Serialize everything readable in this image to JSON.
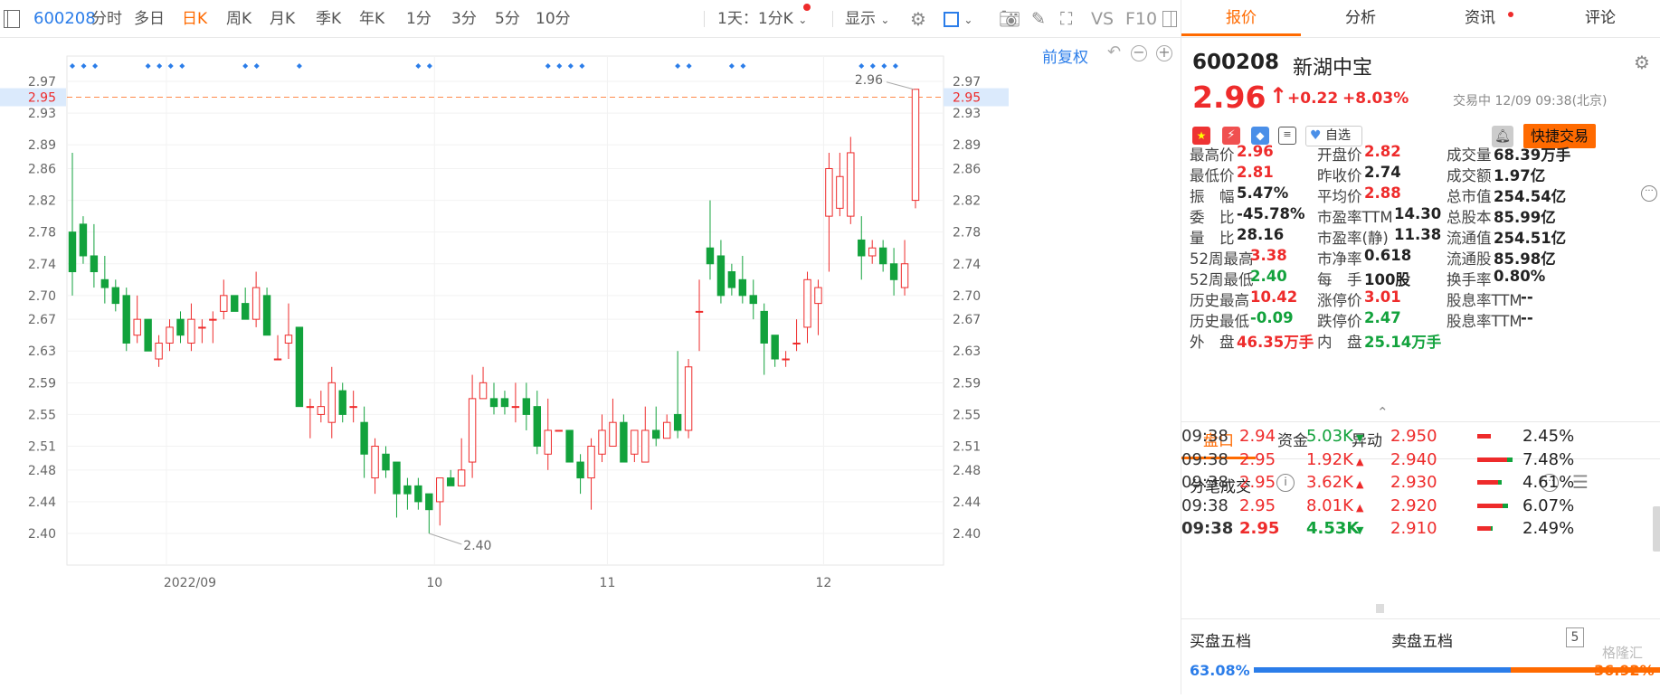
{
  "toolbar": {
    "code": "600208",
    "tabs": [
      "分时",
      "多日",
      "日K",
      "周K",
      "月K",
      "季K",
      "年K",
      "1分",
      "3分",
      "5分",
      "10分"
    ],
    "active_tab": "日K",
    "period_select": "1天：1分K",
    "display_select": "显示",
    "vs": "VS",
    "f10": "F10"
  },
  "chart": {
    "restore_label": "前复权",
    "y_ticks": [
      "2.97",
      "2.93",
      "2.89",
      "2.86",
      "2.82",
      "2.78",
      "2.74",
      "2.70",
      "2.67",
      "2.63",
      "2.59",
      "2.55",
      "2.51",
      "2.48",
      "2.44",
      "2.40"
    ],
    "cursor_price": "2.95",
    "x_labels": [
      "2022/09",
      "10",
      "11",
      "12"
    ],
    "high_label": "2.96",
    "low_label": "2.40",
    "candles": [
      [
        2.78,
        2.73,
        2.88,
        2.7
      ],
      [
        2.79,
        2.75,
        2.8,
        2.74
      ],
      [
        2.75,
        2.73,
        2.79,
        2.71
      ],
      [
        2.72,
        2.71,
        2.75,
        2.69
      ],
      [
        2.71,
        2.69,
        2.72,
        2.68
      ],
      [
        2.7,
        2.64,
        2.71,
        2.63
      ],
      [
        2.65,
        2.67,
        2.7,
        2.64
      ],
      [
        2.67,
        2.63,
        2.67,
        2.63
      ],
      [
        2.62,
        2.64,
        2.65,
        2.61
      ],
      [
        2.64,
        2.66,
        2.67,
        2.63
      ],
      [
        2.67,
        2.65,
        2.68,
        2.64
      ],
      [
        2.64,
        2.67,
        2.69,
        2.63
      ],
      [
        2.66,
        2.66,
        2.67,
        2.64
      ],
      [
        2.67,
        2.67,
        2.68,
        2.64
      ],
      [
        2.68,
        2.7,
        2.72,
        2.67
      ],
      [
        2.7,
        2.68,
        2.7,
        2.68
      ],
      [
        2.69,
        2.67,
        2.71,
        2.67
      ],
      [
        2.67,
        2.71,
        2.73,
        2.66
      ],
      [
        2.7,
        2.65,
        2.71,
        2.65
      ],
      [
        2.62,
        2.62,
        2.65,
        2.62
      ],
      [
        2.64,
        2.65,
        2.69,
        2.62
      ],
      [
        2.66,
        2.56,
        2.66,
        2.56
      ],
      [
        2.56,
        2.56,
        2.57,
        2.52
      ],
      [
        2.55,
        2.56,
        2.58,
        2.54
      ],
      [
        2.54,
        2.59,
        2.61,
        2.52
      ],
      [
        2.58,
        2.55,
        2.59,
        2.54
      ],
      [
        2.56,
        2.56,
        2.58,
        2.54
      ],
      [
        2.54,
        2.5,
        2.56,
        2.47
      ],
      [
        2.47,
        2.51,
        2.52,
        2.45
      ],
      [
        2.5,
        2.48,
        2.51,
        2.47
      ],
      [
        2.49,
        2.45,
        2.49,
        2.42
      ],
      [
        2.46,
        2.45,
        2.47,
        2.43
      ],
      [
        2.46,
        2.44,
        2.47,
        2.43
      ],
      [
        2.45,
        2.43,
        2.45,
        2.4
      ],
      [
        2.44,
        2.47,
        2.47,
        2.41
      ],
      [
        2.47,
        2.46,
        2.48,
        2.46
      ],
      [
        2.46,
        2.48,
        2.52,
        2.46
      ],
      [
        2.49,
        2.57,
        2.6,
        2.47
      ],
      [
        2.57,
        2.59,
        2.61,
        2.57
      ],
      [
        2.57,
        2.56,
        2.59,
        2.55
      ],
      [
        2.57,
        2.56,
        2.58,
        2.55
      ],
      [
        2.56,
        2.56,
        2.59,
        2.54
      ],
      [
        2.57,
        2.55,
        2.59,
        2.53
      ],
      [
        2.56,
        2.51,
        2.58,
        2.5
      ],
      [
        2.5,
        2.53,
        2.57,
        2.48
      ],
      [
        2.53,
        2.53,
        2.53,
        2.53
      ],
      [
        2.53,
        2.49,
        2.53,
        2.49
      ],
      [
        2.49,
        2.47,
        2.5,
        2.45
      ],
      [
        2.47,
        2.51,
        2.52,
        2.43
      ],
      [
        2.5,
        2.53,
        2.55,
        2.49
      ],
      [
        2.51,
        2.54,
        2.57,
        2.51
      ],
      [
        2.54,
        2.49,
        2.55,
        2.49
      ],
      [
        2.5,
        2.53,
        2.53,
        2.49
      ],
      [
        2.49,
        2.53,
        2.56,
        2.49
      ],
      [
        2.53,
        2.52,
        2.56,
        2.51
      ],
      [
        2.52,
        2.54,
        2.55,
        2.52
      ],
      [
        2.55,
        2.53,
        2.63,
        2.52
      ],
      [
        2.53,
        2.61,
        2.62,
        2.52
      ],
      [
        2.68,
        2.68,
        2.72,
        2.63
      ],
      [
        2.76,
        2.74,
        2.82,
        2.72
      ],
      [
        2.75,
        2.7,
        2.77,
        2.69
      ],
      [
        2.73,
        2.71,
        2.74,
        2.7
      ],
      [
        2.72,
        2.7,
        2.75,
        2.69
      ],
      [
        2.7,
        2.69,
        2.72,
        2.67
      ],
      [
        2.68,
        2.64,
        2.69,
        2.6
      ],
      [
        2.65,
        2.62,
        2.65,
        2.61
      ],
      [
        2.62,
        2.62,
        2.63,
        2.61
      ],
      [
        2.64,
        2.64,
        2.67,
        2.63
      ],
      [
        2.66,
        2.72,
        2.73,
        2.64
      ],
      [
        2.69,
        2.71,
        2.72,
        2.65
      ],
      [
        2.8,
        2.86,
        2.88,
        2.73
      ],
      [
        2.81,
        2.85,
        2.88,
        2.8
      ],
      [
        2.8,
        2.88,
        2.9,
        2.79
      ],
      [
        2.77,
        2.75,
        2.8,
        2.72
      ],
      [
        2.75,
        2.76,
        2.77,
        2.74
      ],
      [
        2.76,
        2.74,
        2.77,
        2.73
      ],
      [
        2.74,
        2.72,
        2.76,
        2.7
      ],
      [
        2.71,
        2.74,
        2.77,
        2.7
      ],
      [
        2.82,
        2.96,
        2.96,
        2.81
      ]
    ],
    "marker_groups": [
      3,
      4,
      2,
      1,
      2,
      4,
      2,
      2,
      4
    ]
  },
  "stock": {
    "code": "600208",
    "name": "新湖中宝",
    "price": "2.96",
    "change": "+0.22",
    "change_pct": "+8.03%",
    "status": "交易中 12/09 09:38(北京)",
    "fav_label": "自选",
    "quick_trade": "快捷交易"
  },
  "right_tabs": [
    "报价",
    "分析",
    "资讯",
    "评论"
  ],
  "quote": [
    [
      {
        "l": "最高价",
        "v": "2.96",
        "c": "up"
      },
      {
        "l": "开盘价",
        "v": "2.82",
        "c": "up"
      },
      {
        "l": "成交量",
        "v": "68.39万手",
        "c": "gray"
      }
    ],
    [
      {
        "l": "最低价",
        "v": "2.81",
        "c": "up"
      },
      {
        "l": "昨收价",
        "v": "2.74",
        "c": "gray"
      },
      {
        "l": "成交额",
        "v": "1.97亿",
        "c": "gray"
      }
    ],
    [
      {
        "l": "振　幅",
        "v": "5.47%",
        "c": "gray"
      },
      {
        "l": "平均价",
        "v": "2.88",
        "c": "up"
      },
      {
        "l": "总市值",
        "v": "254.54亿",
        "c": "gray"
      }
    ],
    [
      {
        "l": "委　比",
        "v": "-45.78%",
        "c": "gray"
      },
      {
        "l": "市盈率TTM",
        "v": "14.30",
        "c": "gray"
      },
      {
        "l": "总股本",
        "v": "85.99亿",
        "c": "gray"
      }
    ],
    [
      {
        "l": "量　比",
        "v": "28.16",
        "c": "gray"
      },
      {
        "l": "市盈率(静)",
        "v": "11.38",
        "c": "gray"
      },
      {
        "l": "流通值",
        "v": "254.51亿",
        "c": "gray"
      }
    ],
    [
      {
        "l": "52周最高",
        "v": "3.38",
        "c": "up"
      },
      {
        "l": "市净率",
        "v": "0.618",
        "c": "gray"
      },
      {
        "l": "流通股",
        "v": "85.98亿",
        "c": "gray"
      }
    ],
    [
      {
        "l": "52周最低",
        "v": "2.40",
        "c": "dn"
      },
      {
        "l": "每　手",
        "v": "100股",
        "c": "gray"
      },
      {
        "l": "换手率",
        "v": "0.80%",
        "c": "gray"
      }
    ],
    [
      {
        "l": "历史最高",
        "v": "10.42",
        "c": "up"
      },
      {
        "l": "涨停价",
        "v": "3.01",
        "c": "up"
      },
      {
        "l": "股息率TTM",
        "v": "--",
        "c": "gray"
      }
    ],
    [
      {
        "l": "历史最低",
        "v": "-0.09",
        "c": "dn"
      },
      {
        "l": "跌停价",
        "v": "2.47",
        "c": "dn"
      },
      {
        "l": "股息率TTM",
        "v": "--",
        "c": "gray"
      }
    ],
    [
      {
        "l": "外　盘",
        "v": "46.35万手",
        "c": "up"
      },
      {
        "l": "内　盘",
        "v": "25.14万手",
        "c": "dn"
      }
    ]
  ],
  "sub_tabs": [
    "盘口",
    "资金",
    "异动"
  ],
  "trades_title": "分笔成交",
  "trades": [
    {
      "t": "09:38",
      "p": "2.94",
      "v": "5.03K",
      "d": "dn"
    },
    {
      "t": "09:38",
      "p": "2.95",
      "v": "1.92K",
      "d": "up"
    },
    {
      "t": "09:38",
      "p": "2.95",
      "v": "3.62K",
      "d": "up"
    },
    {
      "t": "09:38",
      "p": "2.95",
      "v": "8.01K",
      "d": "up"
    },
    {
      "t": "09:38",
      "p": "2.95",
      "v": "4.53K",
      "d": "dn"
    }
  ],
  "depth": [
    {
      "p": "2.950",
      "pct": "2.45%",
      "r": 0.3,
      "g": 0.0
    },
    {
      "p": "2.940",
      "pct": "7.48%",
      "r": 0.65,
      "g": 0.3
    },
    {
      "p": "2.930",
      "pct": "4.61%",
      "r": 0.45,
      "g": 0.2
    },
    {
      "p": "2.920",
      "pct": "6.07%",
      "r": 0.55,
      "g": 0.3
    },
    {
      "p": "2.910",
      "pct": "2.49%",
      "r": 0.3,
      "g": 0.1
    }
  ],
  "bid_title": "买盘五档",
  "ask_title": "卖盘五档",
  "levels": "5",
  "bid_pct": "63.08%",
  "ask_pct": "36.92%",
  "bid_ratio": 0.6308,
  "watermark": "格隆汇",
  "colors": {
    "up": "#ee2b2b",
    "down": "#12a23c",
    "accent": "#ff6a00",
    "blue": "#2b7de9"
  }
}
